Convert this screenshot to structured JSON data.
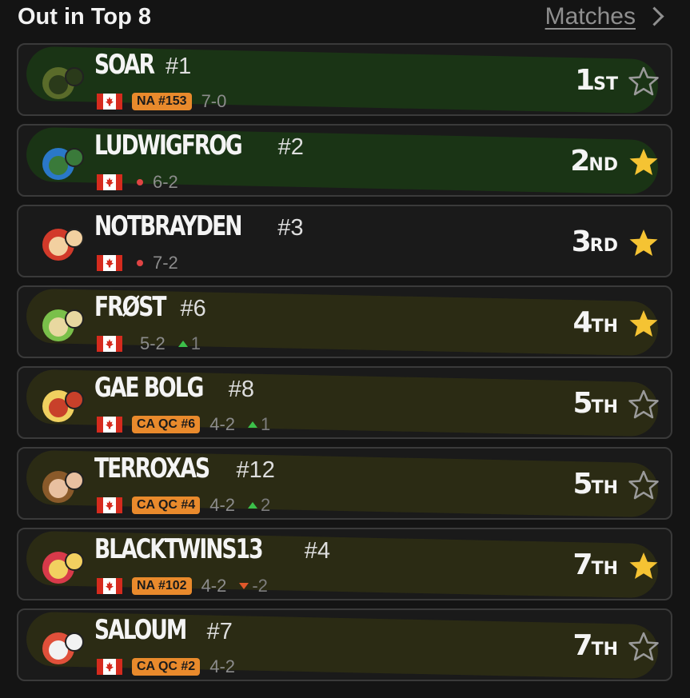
{
  "header": {
    "title": "Out in Top 8",
    "matches_label": "Matches"
  },
  "colors": {
    "badge": "#e98a2c",
    "star_filled": "#f5c333",
    "highlight_green": "#1c4a12",
    "highlight_olive": "#3a3a10"
  },
  "players": [
    {
      "name": "SOAR",
      "seed": "#1",
      "flag": "Canada",
      "badge": "NA #153",
      "dot": false,
      "record": "7-0",
      "trend": null,
      "placement_num": "1",
      "placement_suffix": "ST",
      "starred": false
    },
    {
      "name": "LUDWIGFROG",
      "seed": "#2",
      "flag": "Canada",
      "badge": null,
      "dot": true,
      "record": "6-2",
      "trend": null,
      "placement_num": "2",
      "placement_suffix": "ND",
      "starred": true
    },
    {
      "name": "NOTBRAYDEN",
      "seed": "#3",
      "flag": "Canada",
      "badge": null,
      "dot": true,
      "record": "7-2",
      "trend": null,
      "placement_num": "3",
      "placement_suffix": "RD",
      "starred": true
    },
    {
      "name": "FRØST",
      "seed": "#6",
      "flag": "Canada",
      "badge": null,
      "dot": false,
      "record": "5-2",
      "trend": {
        "dir": "up",
        "value": "1"
      },
      "placement_num": "4",
      "placement_suffix": "TH",
      "starred": true
    },
    {
      "name": "GAE BOLG",
      "seed": "#8",
      "flag": "Canada",
      "badge": "CA QC #6",
      "dot": false,
      "record": "4-2",
      "trend": {
        "dir": "up",
        "value": "1"
      },
      "placement_num": "5",
      "placement_suffix": "TH",
      "starred": false
    },
    {
      "name": "TERROXAS",
      "seed": "#12",
      "flag": "Canada",
      "badge": "CA QC #4",
      "dot": false,
      "record": "4-2",
      "trend": {
        "dir": "up",
        "value": "2"
      },
      "placement_num": "5",
      "placement_suffix": "TH",
      "starred": false
    },
    {
      "name": "BLACKTWINS13",
      "seed": "#4",
      "flag": "Canada",
      "badge": "NA #102",
      "dot": false,
      "record": "4-2",
      "trend": {
        "dir": "down",
        "value": "-2"
      },
      "placement_num": "7",
      "placement_suffix": "TH",
      "starred": true
    },
    {
      "name": "SALOUM",
      "seed": "#7",
      "flag": "Canada",
      "badge": "CA QC #2",
      "dot": false,
      "record": "4-2",
      "trend": null,
      "placement_num": "7",
      "placement_suffix": "TH",
      "starred": false
    }
  ]
}
